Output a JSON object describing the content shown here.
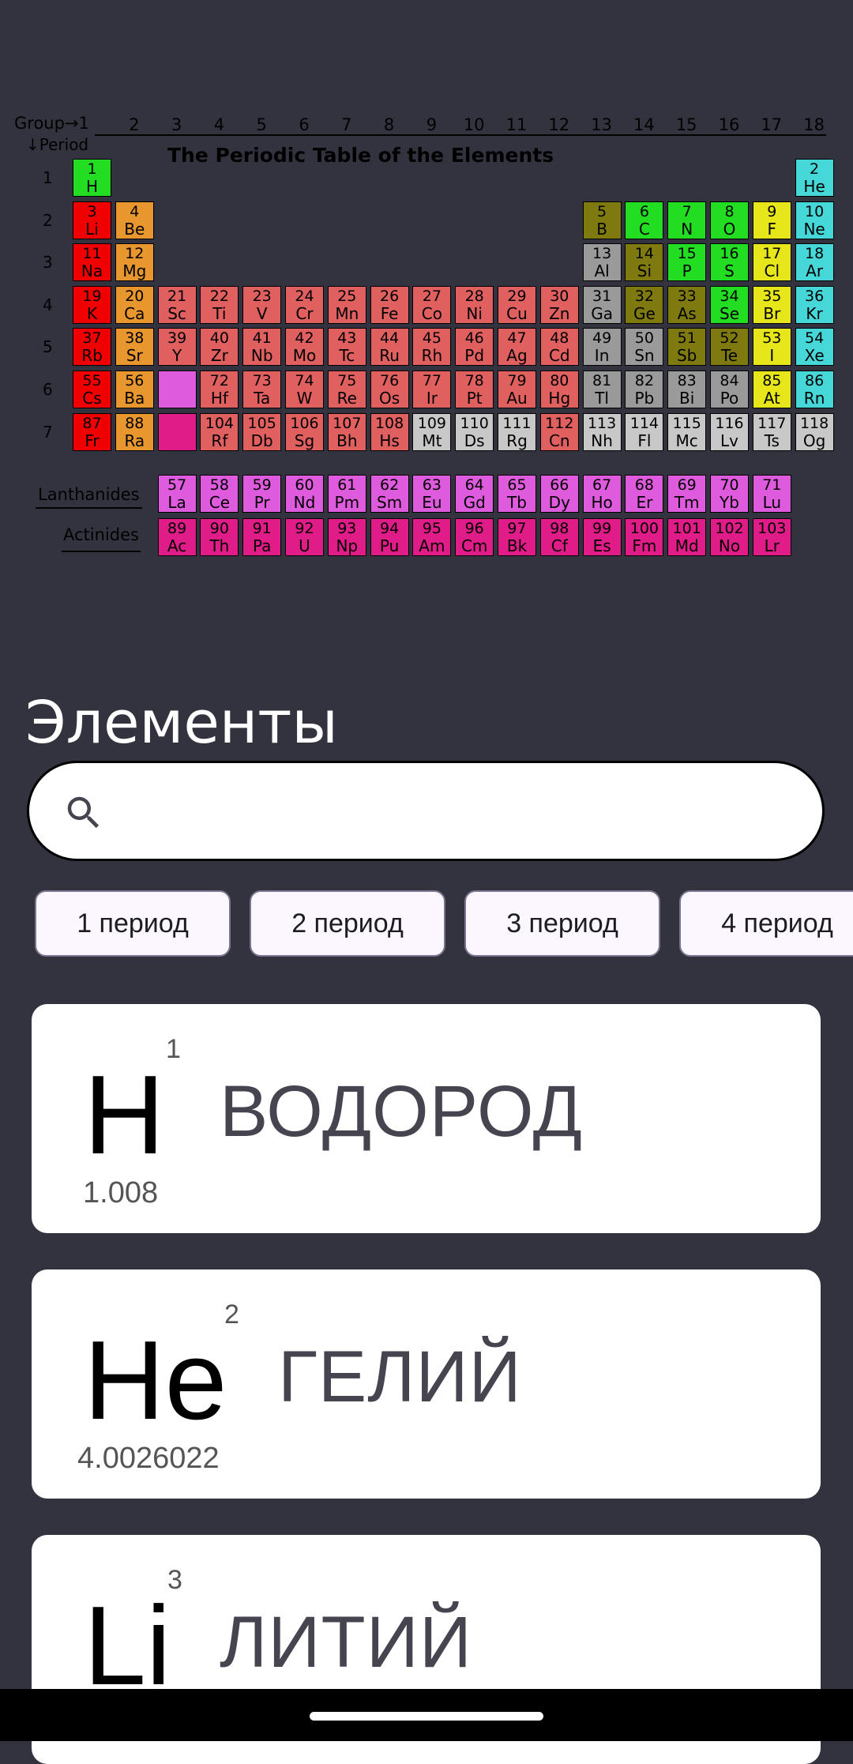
{
  "periodic_table": {
    "title": "The Periodic Table of the Elements",
    "group_caption": "Group→1",
    "period_caption": "↓Period",
    "groups": [
      "2",
      "3",
      "4",
      "5",
      "6",
      "7",
      "8",
      "9",
      "10",
      "11",
      "12",
      "13",
      "14",
      "15",
      "16",
      "17",
      "18"
    ],
    "periods": [
      "1",
      "2",
      "3",
      "4",
      "5",
      "6",
      "7"
    ],
    "lanthanides_label": "Lanthanides",
    "actinides_label": "Actinides",
    "category_colors": {
      "alkali": "#f00000",
      "alkaline": "#e8962e",
      "transition": "#e06060",
      "post": "#9a9a9a",
      "metalloid": "#7e7a10",
      "nonmetal": "#22dd22",
      "halogen": "#e6e61a",
      "noble": "#46d8d8",
      "unknown": "#c8c8c8",
      "lanthanide": "#de5bde",
      "actinide": "#df1c87"
    },
    "main_elements": [
      {
        "n": "1",
        "s": "H",
        "g": 1,
        "p": 1,
        "c": "nonmetal"
      },
      {
        "n": "2",
        "s": "He",
        "g": 18,
        "p": 1,
        "c": "noble"
      },
      {
        "n": "3",
        "s": "Li",
        "g": 1,
        "p": 2,
        "c": "alkali"
      },
      {
        "n": "4",
        "s": "Be",
        "g": 2,
        "p": 2,
        "c": "alkaline"
      },
      {
        "n": "5",
        "s": "B",
        "g": 13,
        "p": 2,
        "c": "metalloid"
      },
      {
        "n": "6",
        "s": "C",
        "g": 14,
        "p": 2,
        "c": "nonmetal"
      },
      {
        "n": "7",
        "s": "N",
        "g": 15,
        "p": 2,
        "c": "nonmetal"
      },
      {
        "n": "8",
        "s": "O",
        "g": 16,
        "p": 2,
        "c": "nonmetal"
      },
      {
        "n": "9",
        "s": "F",
        "g": 17,
        "p": 2,
        "c": "halogen"
      },
      {
        "n": "10",
        "s": "Ne",
        "g": 18,
        "p": 2,
        "c": "noble"
      },
      {
        "n": "11",
        "s": "Na",
        "g": 1,
        "p": 3,
        "c": "alkali"
      },
      {
        "n": "12",
        "s": "Mg",
        "g": 2,
        "p": 3,
        "c": "alkaline"
      },
      {
        "n": "13",
        "s": "Al",
        "g": 13,
        "p": 3,
        "c": "post"
      },
      {
        "n": "14",
        "s": "Si",
        "g": 14,
        "p": 3,
        "c": "metalloid"
      },
      {
        "n": "15",
        "s": "P",
        "g": 15,
        "p": 3,
        "c": "nonmetal"
      },
      {
        "n": "16",
        "s": "S",
        "g": 16,
        "p": 3,
        "c": "nonmetal"
      },
      {
        "n": "17",
        "s": "Cl",
        "g": 17,
        "p": 3,
        "c": "halogen"
      },
      {
        "n": "18",
        "s": "Ar",
        "g": 18,
        "p": 3,
        "c": "noble"
      },
      {
        "n": "19",
        "s": "K",
        "g": 1,
        "p": 4,
        "c": "alkali"
      },
      {
        "n": "20",
        "s": "Ca",
        "g": 2,
        "p": 4,
        "c": "alkaline"
      },
      {
        "n": "21",
        "s": "Sc",
        "g": 3,
        "p": 4,
        "c": "transition"
      },
      {
        "n": "22",
        "s": "Ti",
        "g": 4,
        "p": 4,
        "c": "transition"
      },
      {
        "n": "23",
        "s": "V",
        "g": 5,
        "p": 4,
        "c": "transition"
      },
      {
        "n": "24",
        "s": "Cr",
        "g": 6,
        "p": 4,
        "c": "transition"
      },
      {
        "n": "25",
        "s": "Mn",
        "g": 7,
        "p": 4,
        "c": "transition"
      },
      {
        "n": "26",
        "s": "Fe",
        "g": 8,
        "p": 4,
        "c": "transition"
      },
      {
        "n": "27",
        "s": "Co",
        "g": 9,
        "p": 4,
        "c": "transition"
      },
      {
        "n": "28",
        "s": "Ni",
        "g": 10,
        "p": 4,
        "c": "transition"
      },
      {
        "n": "29",
        "s": "Cu",
        "g": 11,
        "p": 4,
        "c": "transition"
      },
      {
        "n": "30",
        "s": "Zn",
        "g": 12,
        "p": 4,
        "c": "transition"
      },
      {
        "n": "31",
        "s": "Ga",
        "g": 13,
        "p": 4,
        "c": "post"
      },
      {
        "n": "32",
        "s": "Ge",
        "g": 14,
        "p": 4,
        "c": "metalloid"
      },
      {
        "n": "33",
        "s": "As",
        "g": 15,
        "p": 4,
        "c": "metalloid"
      },
      {
        "n": "34",
        "s": "Se",
        "g": 16,
        "p": 4,
        "c": "nonmetal"
      },
      {
        "n": "35",
        "s": "Br",
        "g": 17,
        "p": 4,
        "c": "halogen"
      },
      {
        "n": "36",
        "s": "Kr",
        "g": 18,
        "p": 4,
        "c": "noble"
      },
      {
        "n": "37",
        "s": "Rb",
        "g": 1,
        "p": 5,
        "c": "alkali"
      },
      {
        "n": "38",
        "s": "Sr",
        "g": 2,
        "p": 5,
        "c": "alkaline"
      },
      {
        "n": "39",
        "s": "Y",
        "g": 3,
        "p": 5,
        "c": "transition"
      },
      {
        "n": "40",
        "s": "Zr",
        "g": 4,
        "p": 5,
        "c": "transition"
      },
      {
        "n": "41",
        "s": "Nb",
        "g": 5,
        "p": 5,
        "c": "transition"
      },
      {
        "n": "42",
        "s": "Mo",
        "g": 6,
        "p": 5,
        "c": "transition"
      },
      {
        "n": "43",
        "s": "Tc",
        "g": 7,
        "p": 5,
        "c": "transition"
      },
      {
        "n": "44",
        "s": "Ru",
        "g": 8,
        "p": 5,
        "c": "transition"
      },
      {
        "n": "45",
        "s": "Rh",
        "g": 9,
        "p": 5,
        "c": "transition"
      },
      {
        "n": "46",
        "s": "Pd",
        "g": 10,
        "p": 5,
        "c": "transition"
      },
      {
        "n": "47",
        "s": "Ag",
        "g": 11,
        "p": 5,
        "c": "transition"
      },
      {
        "n": "48",
        "s": "Cd",
        "g": 12,
        "p": 5,
        "c": "transition"
      },
      {
        "n": "49",
        "s": "In",
        "g": 13,
        "p": 5,
        "c": "post"
      },
      {
        "n": "50",
        "s": "Sn",
        "g": 14,
        "p": 5,
        "c": "post"
      },
      {
        "n": "51",
        "s": "Sb",
        "g": 15,
        "p": 5,
        "c": "metalloid"
      },
      {
        "n": "52",
        "s": "Te",
        "g": 16,
        "p": 5,
        "c": "metalloid"
      },
      {
        "n": "53",
        "s": "I",
        "g": 17,
        "p": 5,
        "c": "halogen"
      },
      {
        "n": "54",
        "s": "Xe",
        "g": 18,
        "p": 5,
        "c": "noble"
      },
      {
        "n": "55",
        "s": "Cs",
        "g": 1,
        "p": 6,
        "c": "alkali"
      },
      {
        "n": "56",
        "s": "Ba",
        "g": 2,
        "p": 6,
        "c": "alkaline"
      },
      {
        "n": "",
        "s": "",
        "g": 3,
        "p": 6,
        "c": "lanthanide"
      },
      {
        "n": "72",
        "s": "Hf",
        "g": 4,
        "p": 6,
        "c": "transition"
      },
      {
        "n": "73",
        "s": "Ta",
        "g": 5,
        "p": 6,
        "c": "transition"
      },
      {
        "n": "74",
        "s": "W",
        "g": 6,
        "p": 6,
        "c": "transition"
      },
      {
        "n": "75",
        "s": "Re",
        "g": 7,
        "p": 6,
        "c": "transition"
      },
      {
        "n": "76",
        "s": "Os",
        "g": 8,
        "p": 6,
        "c": "transition"
      },
      {
        "n": "77",
        "s": "Ir",
        "g": 9,
        "p": 6,
        "c": "transition"
      },
      {
        "n": "78",
        "s": "Pt",
        "g": 10,
        "p": 6,
        "c": "transition"
      },
      {
        "n": "79",
        "s": "Au",
        "g": 11,
        "p": 6,
        "c": "transition"
      },
      {
        "n": "80",
        "s": "Hg",
        "g": 12,
        "p": 6,
        "c": "transition"
      },
      {
        "n": "81",
        "s": "Tl",
        "g": 13,
        "p": 6,
        "c": "post"
      },
      {
        "n": "82",
        "s": "Pb",
        "g": 14,
        "p": 6,
        "c": "post"
      },
      {
        "n": "83",
        "s": "Bi",
        "g": 15,
        "p": 6,
        "c": "post"
      },
      {
        "n": "84",
        "s": "Po",
        "g": 16,
        "p": 6,
        "c": "post"
      },
      {
        "n": "85",
        "s": "At",
        "g": 17,
        "p": 6,
        "c": "halogen"
      },
      {
        "n": "86",
        "s": "Rn",
        "g": 18,
        "p": 6,
        "c": "noble"
      },
      {
        "n": "87",
        "s": "Fr",
        "g": 1,
        "p": 7,
        "c": "alkali"
      },
      {
        "n": "88",
        "s": "Ra",
        "g": 2,
        "p": 7,
        "c": "alkaline"
      },
      {
        "n": "",
        "s": "",
        "g": 3,
        "p": 7,
        "c": "actinide"
      },
      {
        "n": "104",
        "s": "Rf",
        "g": 4,
        "p": 7,
        "c": "transition"
      },
      {
        "n": "105",
        "s": "Db",
        "g": 5,
        "p": 7,
        "c": "transition"
      },
      {
        "n": "106",
        "s": "Sg",
        "g": 6,
        "p": 7,
        "c": "transition"
      },
      {
        "n": "107",
        "s": "Bh",
        "g": 7,
        "p": 7,
        "c": "transition"
      },
      {
        "n": "108",
        "s": "Hs",
        "g": 8,
        "p": 7,
        "c": "transition"
      },
      {
        "n": "109",
        "s": "Mt",
        "g": 9,
        "p": 7,
        "c": "unknown"
      },
      {
        "n": "110",
        "s": "Ds",
        "g": 10,
        "p": 7,
        "c": "unknown"
      },
      {
        "n": "111",
        "s": "Rg",
        "g": 11,
        "p": 7,
        "c": "unknown"
      },
      {
        "n": "112",
        "s": "Cn",
        "g": 12,
        "p": 7,
        "c": "transition"
      },
      {
        "n": "113",
        "s": "Nh",
        "g": 13,
        "p": 7,
        "c": "unknown"
      },
      {
        "n": "114",
        "s": "Fl",
        "g": 14,
        "p": 7,
        "c": "unknown"
      },
      {
        "n": "115",
        "s": "Mc",
        "g": 15,
        "p": 7,
        "c": "unknown"
      },
      {
        "n": "116",
        "s": "Lv",
        "g": 16,
        "p": 7,
        "c": "unknown"
      },
      {
        "n": "117",
        "s": "Ts",
        "g": 17,
        "p": 7,
        "c": "unknown"
      },
      {
        "n": "118",
        "s": "Og",
        "g": 18,
        "p": 7,
        "c": "unknown"
      }
    ],
    "lanthanides": [
      {
        "n": "57",
        "s": "La"
      },
      {
        "n": "58",
        "s": "Ce"
      },
      {
        "n": "59",
        "s": "Pr"
      },
      {
        "n": "60",
        "s": "Nd"
      },
      {
        "n": "61",
        "s": "Pm"
      },
      {
        "n": "62",
        "s": "Sm"
      },
      {
        "n": "63",
        "s": "Eu"
      },
      {
        "n": "64",
        "s": "Gd"
      },
      {
        "n": "65",
        "s": "Tb"
      },
      {
        "n": "66",
        "s": "Dy"
      },
      {
        "n": "67",
        "s": "Ho"
      },
      {
        "n": "68",
        "s": "Er"
      },
      {
        "n": "69",
        "s": "Tm"
      },
      {
        "n": "70",
        "s": "Yb"
      },
      {
        "n": "71",
        "s": "Lu"
      }
    ],
    "actinides": [
      {
        "n": "89",
        "s": "Ac"
      },
      {
        "n": "90",
        "s": "Th"
      },
      {
        "n": "91",
        "s": "Pa"
      },
      {
        "n": "92",
        "s": "U"
      },
      {
        "n": "93",
        "s": "Np"
      },
      {
        "n": "94",
        "s": "Pu"
      },
      {
        "n": "95",
        "s": "Am"
      },
      {
        "n": "96",
        "s": "Cm"
      },
      {
        "n": "97",
        "s": "Bk"
      },
      {
        "n": "98",
        "s": "Cf"
      },
      {
        "n": "99",
        "s": "Es"
      },
      {
        "n": "100",
        "s": "Fm"
      },
      {
        "n": "101",
        "s": "Md"
      },
      {
        "n": "102",
        "s": "No"
      },
      {
        "n": "103",
        "s": "Lr"
      }
    ]
  },
  "heading": "Элементы",
  "search": {
    "value": "",
    "placeholder": "",
    "icon": "search-icon"
  },
  "chips": [
    "1 период",
    "2 период",
    "3 период",
    "4 период"
  ],
  "elements": [
    {
      "symbol": "H",
      "number": "1",
      "name": "ВОДОРОД",
      "mass": "1.008"
    },
    {
      "symbol": "He",
      "number": "2",
      "name": "ГЕЛИЙ",
      "mass": "4.0026022"
    },
    {
      "symbol": "Li",
      "number": "3",
      "name": "ЛИТИЙ",
      "mass": ""
    }
  ],
  "colors": {
    "background": "#32333f",
    "card": "#ffffff",
    "chip_bg": "#fcf6ff",
    "chip_border": "#7a7590"
  }
}
